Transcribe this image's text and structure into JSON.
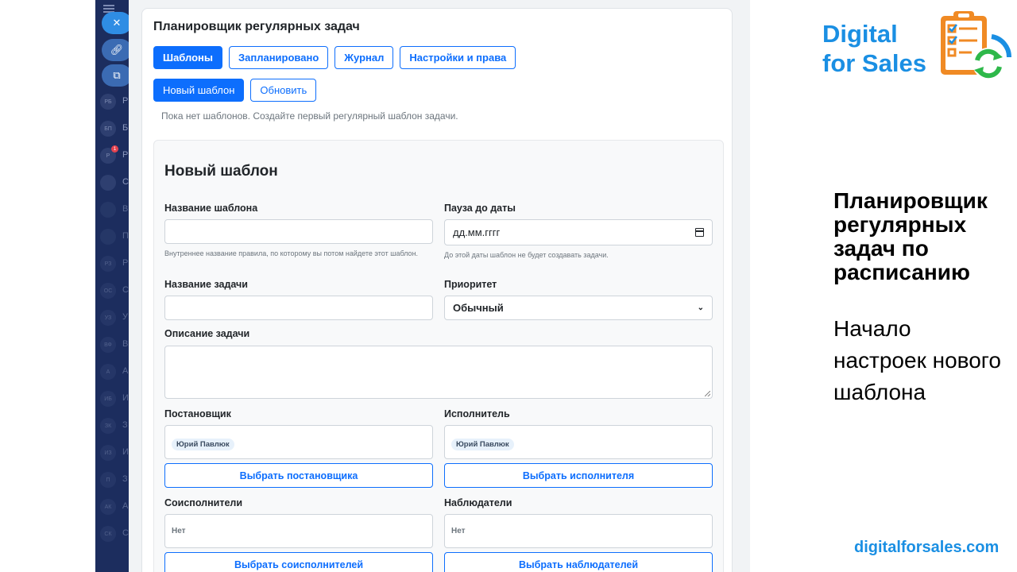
{
  "app": {
    "title": "Планировщик регулярных задач",
    "tabs": [
      {
        "label": "Шаблоны",
        "active": true
      },
      {
        "label": "Запланировано",
        "active": false
      },
      {
        "label": "Журнал",
        "active": false
      },
      {
        "label": "Настройки и права",
        "active": false
      }
    ],
    "actions": {
      "new_template_label": "Новый шаблон",
      "refresh_label": "Обновить"
    },
    "empty_message": "Пока нет шаблонов. Создайте первый регулярный шаблон задачи."
  },
  "sidebar": {
    "items": [
      {
        "abbr": "РБ",
        "letter": "Р"
      },
      {
        "abbr": "БП",
        "letter": "Б"
      },
      {
        "abbr": "Р",
        "letter": "Р",
        "badge": "1"
      },
      {
        "abbr": "",
        "letter": "С",
        "icon": "loader-icon"
      },
      {
        "abbr": "",
        "letter": "В",
        "icon": "cube-icon"
      },
      {
        "abbr": "",
        "letter": "П",
        "icon": "box-icon"
      },
      {
        "abbr": "РЗ",
        "letter": "Р"
      },
      {
        "abbr": "ОС",
        "letter": "С"
      },
      {
        "abbr": "УЗ",
        "letter": "У"
      },
      {
        "abbr": "ВФ",
        "letter": "В"
      },
      {
        "abbr": "А",
        "letter": "А"
      },
      {
        "abbr": "ИБ",
        "letter": "И"
      },
      {
        "abbr": "ЗК",
        "letter": "З"
      },
      {
        "abbr": "ИЗ",
        "letter": "И"
      },
      {
        "abbr": "П",
        "letter": "З"
      },
      {
        "abbr": "АК",
        "letter": "А"
      },
      {
        "abbr": "СК",
        "letter": "С"
      }
    ]
  },
  "form": {
    "title": "Новый шаблон",
    "template_name": {
      "label": "Название шаблона",
      "value": "",
      "help": "Внутреннее название правила, по которому вы потом найдете этот шаблон."
    },
    "pause_until": {
      "label": "Пауза до даты",
      "value": "дд.мм.гггг",
      "help": "До этой даты шаблон не будет создавать задачи."
    },
    "task_name": {
      "label": "Название задачи",
      "value": ""
    },
    "priority": {
      "label": "Приоритет",
      "value": "Обычный"
    },
    "description": {
      "label": "Описание задачи",
      "value": ""
    },
    "creator": {
      "label": "Постановщик",
      "chip": "Юрий Павлюк",
      "button": "Выбрать постановщика"
    },
    "assignee": {
      "label": "Исполнитель",
      "chip": "Юрий Павлюк",
      "button": "Выбрать исполнителя"
    },
    "coexecutors": {
      "label": "Соисполнители",
      "value": "Нет",
      "button": "Выбрать соисполнителей"
    },
    "observers": {
      "label": "Наблюдатели",
      "value": "Нет",
      "button": "Выбрать наблюдателей"
    }
  },
  "branding": {
    "name_line1": "Digital",
    "name_line2": "for Sales",
    "headline": "Планировщик регулярных задач по расписанию",
    "subline": "Начало настроек нового шаблона",
    "url": "digitalforsales.com",
    "accent_color": "#1a8fe3",
    "logo_icon": "clipboard-checklist-cycle-icon"
  },
  "colors": {
    "primary": "#0d6efd",
    "sidebar": "#1c2d5e"
  }
}
